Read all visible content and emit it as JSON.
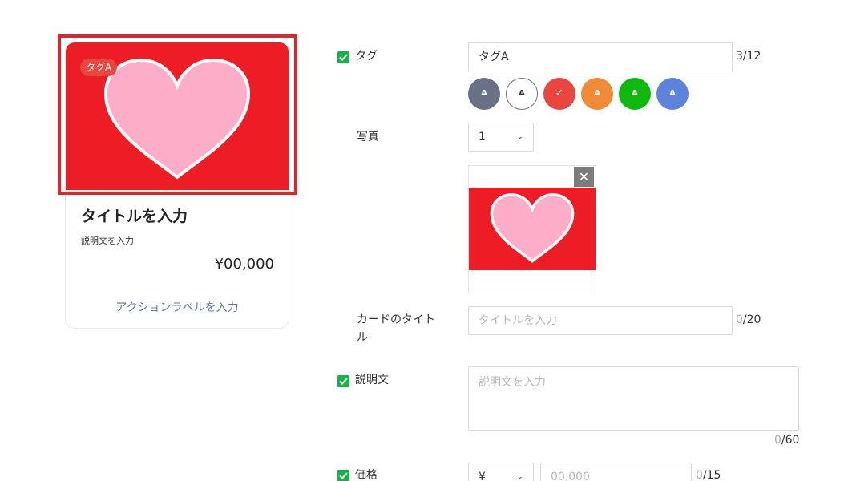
{
  "preview_card": {
    "tag": "タグA",
    "title": "タイトルを入力",
    "description": "説明文を入力",
    "price": "¥00,000",
    "action_label": "アクションラベルを入力",
    "image_icon": "heart-image",
    "image_bg": "#ee1c25",
    "heart_color": "#fcaec8"
  },
  "form": {
    "tag": {
      "label": "タグ",
      "checked": true,
      "value": "タグA",
      "count": "3",
      "max": "/12",
      "colors": [
        {
          "letter": "A",
          "color": "#6b7185",
          "selected": false
        },
        {
          "letter": "A",
          "color": "#ffffff",
          "selected": false
        },
        {
          "letter": "✓",
          "color": "#e8463f",
          "selected": true
        },
        {
          "letter": "A",
          "color": "#ef8a37",
          "selected": false
        },
        {
          "letter": "A",
          "color": "#0fb80f",
          "selected": false
        },
        {
          "letter": "A",
          "color": "#5c84dc",
          "selected": false
        }
      ]
    },
    "photo": {
      "label": "写真",
      "select_value": "1",
      "close_icon": "close-icon"
    },
    "card_title": {
      "label_line1": "カードのタイト",
      "label_line2": "ル",
      "placeholder": "タイトルを入力",
      "count": "0",
      "max": "/20"
    },
    "description": {
      "label": "説明文",
      "checked": true,
      "placeholder": "説明文を入力",
      "count": "0",
      "max": "/60"
    },
    "price": {
      "label": "価格",
      "checked": true,
      "currency": "¥",
      "placeholder": "00,000",
      "count": "0",
      "max": "/15"
    }
  },
  "colors": {
    "check_green": "#17b348",
    "selection_frame": "#e0242b",
    "action_link": "#5b7aa5"
  }
}
